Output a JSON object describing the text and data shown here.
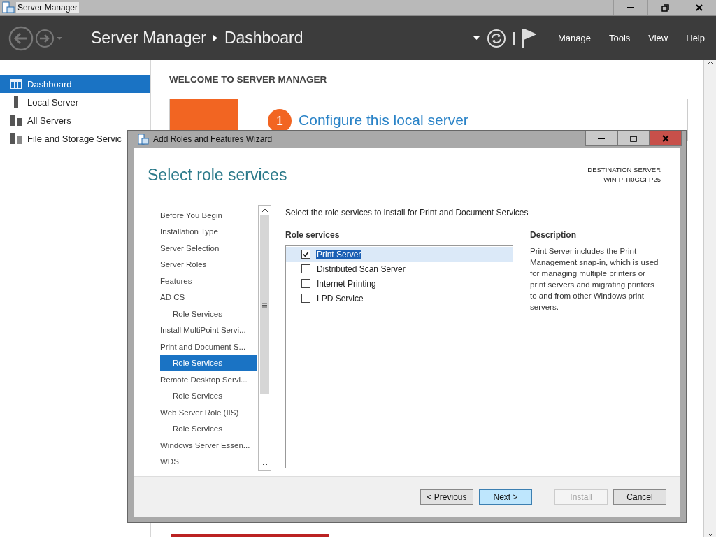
{
  "window": {
    "title": "Server Manager"
  },
  "header": {
    "app": "Server Manager",
    "page": "Dashboard",
    "menu": [
      "Manage",
      "Tools",
      "View",
      "Help"
    ]
  },
  "sidebar": {
    "items": [
      {
        "label": "Dashboard",
        "selected": true
      },
      {
        "label": "Local Server",
        "selected": false
      },
      {
        "label": "All Servers",
        "selected": false
      },
      {
        "label": "File and Storage Servic",
        "selected": false
      }
    ]
  },
  "welcome": {
    "heading": "WELCOME TO SERVER MANAGER",
    "step_number": "1",
    "step_title": "Configure this local server"
  },
  "dialog": {
    "title": "Add Roles and Features Wizard",
    "heading": "Select role services",
    "destination_label": "DESTINATION SERVER",
    "destination_server": "WIN-PITI0GGFP25",
    "steps": [
      {
        "label": "Before You Begin",
        "selected": false
      },
      {
        "label": "Installation Type",
        "selected": false
      },
      {
        "label": "Server Selection",
        "selected": false
      },
      {
        "label": "Server Roles",
        "selected": false
      },
      {
        "label": "Features",
        "selected": false
      },
      {
        "label": "AD CS",
        "selected": false,
        "children": [
          {
            "label": "Role Services",
            "selected": false
          }
        ]
      },
      {
        "label": "Install MultiPoint Servi...",
        "selected": false
      },
      {
        "label": "Print and Document S...",
        "selected": false,
        "children": [
          {
            "label": "Role Services",
            "selected": true
          }
        ]
      },
      {
        "label": "Remote Desktop Servi...",
        "selected": false,
        "children": [
          {
            "label": "Role Services",
            "selected": false
          }
        ]
      },
      {
        "label": "Web Server Role (IIS)",
        "selected": false,
        "children": [
          {
            "label": "Role Services",
            "selected": false
          }
        ]
      },
      {
        "label": "Windows Server Essen...",
        "selected": false
      },
      {
        "label": "WDS",
        "selected": false
      }
    ],
    "intro": "Select the role services to install for Print and Document Services",
    "list_heading": "Role services",
    "role_services": [
      {
        "label": "Print Server",
        "checked": true,
        "selected": true
      },
      {
        "label": "Distributed Scan Server",
        "checked": false,
        "selected": false
      },
      {
        "label": "Internet Printing",
        "checked": false,
        "selected": false
      },
      {
        "label": "LPD Service",
        "checked": false,
        "selected": false
      }
    ],
    "description_heading": "Description",
    "description": "Print Server includes the Print Management snap-in, which is used for managing multiple printers or print servers and migrating printers to and from other Windows print servers.",
    "buttons": [
      {
        "label": "< Previous",
        "disabled": false,
        "selected": false
      },
      {
        "label": "Next >",
        "disabled": false,
        "selected": true
      },
      {
        "label": "Install",
        "disabled": true,
        "selected": false
      },
      {
        "label": "Cancel",
        "disabled": false,
        "selected": false
      }
    ]
  }
}
